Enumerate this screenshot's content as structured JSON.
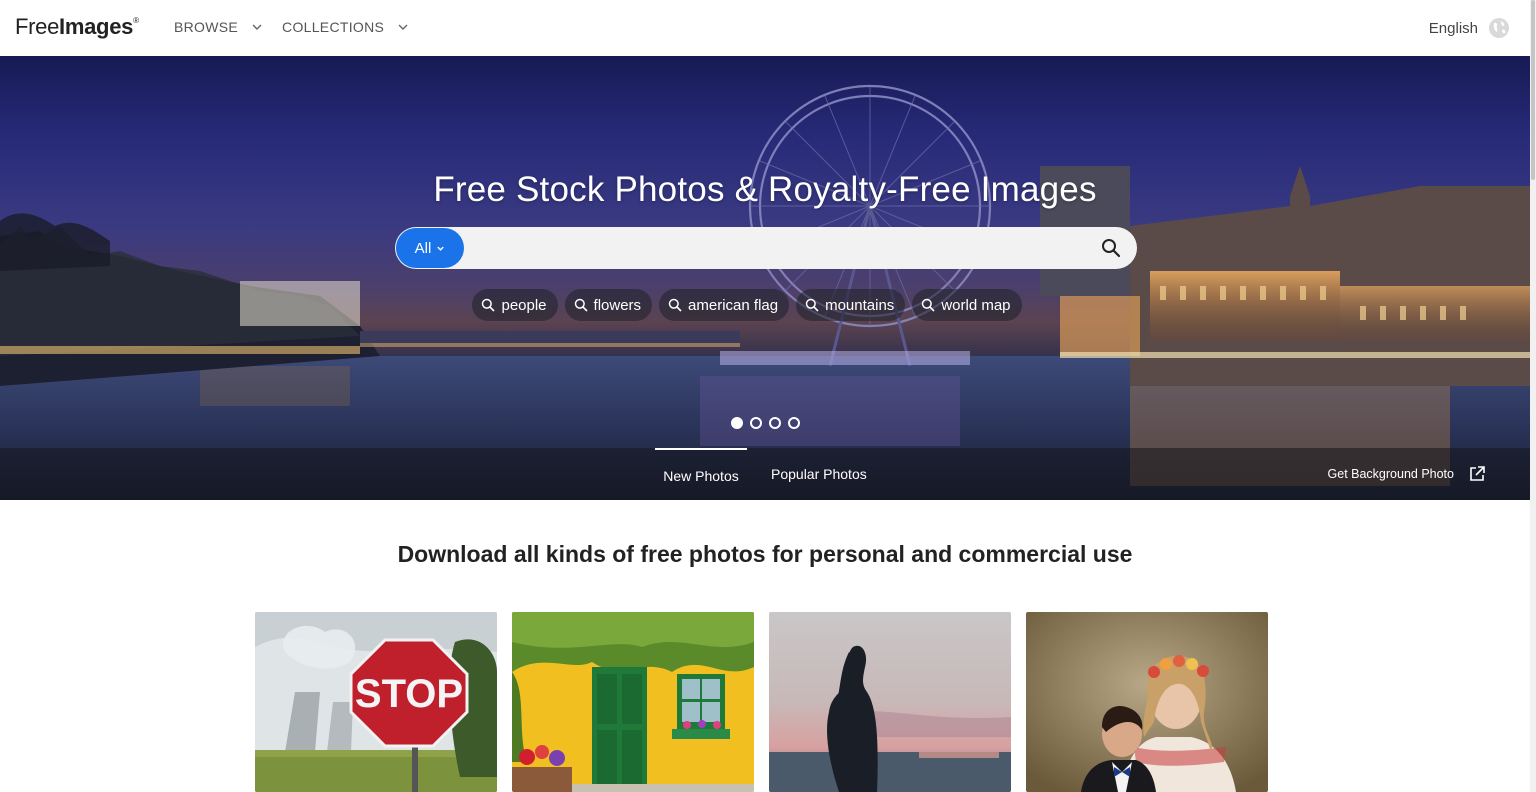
{
  "header": {
    "logo_light": "Free",
    "logo_bold": "Images",
    "logo_mark": "®",
    "nav": [
      {
        "label": "BROWSE"
      },
      {
        "label": "COLLECTIONS"
      }
    ],
    "language": "English"
  },
  "hero": {
    "title": "Free Stock Photos & Royalty-Free Images",
    "search": {
      "scope": "All",
      "value": "",
      "placeholder": ""
    },
    "tags": [
      "people",
      "flowers",
      "american flag",
      "mountains",
      "world map"
    ],
    "carousel": {
      "count": 4,
      "active": 0
    },
    "tabs": [
      {
        "label": "New Photos",
        "active": true
      },
      {
        "label": "Popular Photos",
        "active": false
      }
    ],
    "background_link": "Get Background Photo"
  },
  "content": {
    "lead": "Download all kinds of free photos for personal and commercial use",
    "photos": [
      {
        "subject": "stop sign near cooling towers",
        "sign_text": "STOP"
      },
      {
        "subject": "green door on yellow ivy-covered wall"
      },
      {
        "subject": "woman silhouette in sea at sunset"
      },
      {
        "subject": "two children with flower crown"
      }
    ]
  },
  "colors": {
    "accent": "#1a73e8",
    "text": "#222222",
    "nav_text": "#555555"
  }
}
